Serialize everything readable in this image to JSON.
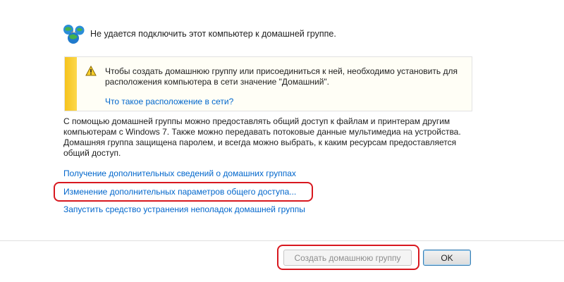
{
  "status": {
    "icon": "network-globe-icon",
    "text": "Не удается подключить этот компьютер к домашней группе."
  },
  "warning": {
    "icon": "warning-icon",
    "text": "Чтобы создать домашнюю группу или присоединиться к ней, необходимо установить для расположения компьютера в сети значение \"Домашний\".",
    "link": "Что такое расположение в сети?",
    "accent_color": "#f6c31c"
  },
  "description": "С помощью домашней группы можно предоставлять общий доступ к файлам и принтерам другим компьютерам с Windows 7. Также можно передавать потоковые данные мультимедиа на устройства. Домашняя группа защищена паролем, и всегда можно выбрать, к каким ресурсам предоставляется общий доступ.",
  "links": {
    "more_info": "Получение дополнительных сведений о домашних группах",
    "advanced_sharing": "Изменение дополнительных параметров общего доступа...",
    "troubleshooter": "Запустить средство устранения неполадок домашней группы"
  },
  "buttons": {
    "create_homegroup": "Создать домашнюю группу",
    "ok": "OK"
  },
  "colors": {
    "link": "#0066cc",
    "highlight": "#d8181f"
  }
}
